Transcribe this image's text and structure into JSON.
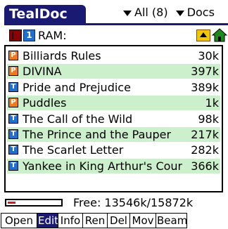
{
  "app": {
    "title": "TealDoc"
  },
  "category": {
    "label": "All (8)",
    "view": "Docs"
  },
  "location": {
    "label": "RAM:",
    "card_number": "1"
  },
  "documents": [
    {
      "name": "Billiards Rules",
      "size": "30k",
      "type": "pdb"
    },
    {
      "name": "DIVINA",
      "size": "397k",
      "type": "pdb"
    },
    {
      "name": "Pride and Prejudice",
      "size": "389k",
      "type": "txt"
    },
    {
      "name": "Puddles",
      "size": "1k",
      "type": "pdb"
    },
    {
      "name": "The Call of the Wild",
      "size": "98k",
      "type": "txt"
    },
    {
      "name": "The Prince and the Pauper",
      "size": "217k",
      "type": "txt"
    },
    {
      "name": "The Scarlet Letter",
      "size": "282k",
      "type": "txt"
    },
    {
      "name": "Yankee in King Arthur's Cour",
      "size": "366k",
      "type": "txt"
    }
  ],
  "memory": {
    "text": "Free: 13546k/15872k",
    "free": 13546,
    "total": 15872
  },
  "buttons": [
    {
      "label": "Open",
      "active": false
    },
    {
      "label": "Edit",
      "active": true
    },
    {
      "label": "Info",
      "active": false
    },
    {
      "label": "Ren",
      "active": false
    },
    {
      "label": "Del",
      "active": false
    },
    {
      "label": "Mov",
      "active": false
    },
    {
      "label": "Beam",
      "active": false
    }
  ],
  "colors": {
    "accent": "#1a1a72",
    "row_alt": "#ccf0cc",
    "memory_bar": "#d81c1c",
    "pdb_icon": "#f07a1a",
    "txt_icon": "#1f6fd0"
  },
  "icons": {
    "card": "memory-card-icon",
    "folder_up": "folder-up-icon",
    "home": "home-icon",
    "pdb": "pdb-document-icon",
    "txt": "text-document-icon"
  }
}
